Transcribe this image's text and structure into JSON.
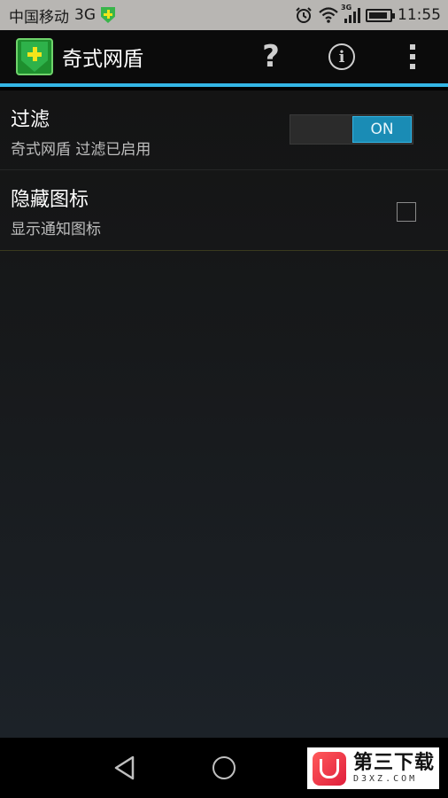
{
  "status_bar": {
    "carrier": "中国移动",
    "network": "3G",
    "signal_tag": "3G",
    "time": "11:55",
    "icons": [
      "shield-notification-icon",
      "alarm-icon",
      "wifi-icon",
      "signal-icon",
      "battery-icon"
    ]
  },
  "action_bar": {
    "title": "奇式网盾",
    "help_glyph": "?",
    "info_glyph": "i",
    "accent_color": "#33b5e5"
  },
  "preferences": [
    {
      "title": "过滤",
      "summary": "奇式网盾 过滤已启用",
      "control": "switch",
      "switch_label": "ON",
      "checked": true
    },
    {
      "title": "隐藏图标",
      "summary": "显示通知图标",
      "control": "checkbox",
      "checked": false
    }
  ],
  "watermark": {
    "title": "第三下载",
    "subtitle": "D3XZ.COM"
  }
}
